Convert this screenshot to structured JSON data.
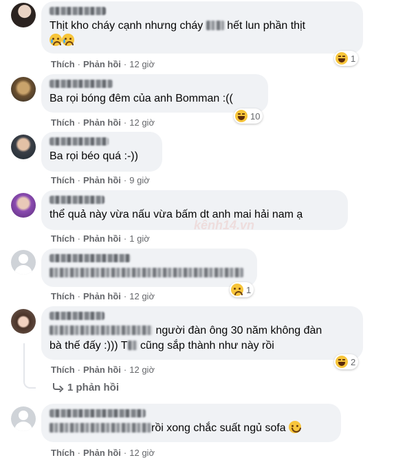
{
  "labels": {
    "like": "Thích",
    "reply": "Phản hồi",
    "separator": "·"
  },
  "colors": {
    "bubble": "#f0f2f5",
    "meta": "#65676b",
    "text": "#050505",
    "reaction_emoji": "#f7c53b"
  },
  "comments": [
    {
      "avatar": "photo-woman",
      "text_before": "Thịt kho cháy cạnh nhưng cháy",
      "text_after": "hết lun phần thịt",
      "text_line2_emoji": "crying-face x2",
      "reaction": {
        "emoji": "haha",
        "count": "1"
      },
      "time": "12 giờ"
    },
    {
      "avatar": "photo-cartoon",
      "text": "Ba rọi bóng đêm của anh Bomman :((",
      "reaction": {
        "emoji": "haha",
        "count": "10"
      },
      "time": "12 giờ"
    },
    {
      "avatar": "photo-man",
      "text": "Ba rọi béo quá :-))",
      "time": "9 giờ"
    },
    {
      "avatar": "photo-purple",
      "text": "thể quả này vừa nấu vừa bấm dt anh mai hải nam ạ",
      "time": "1 giờ"
    },
    {
      "avatar": "generic",
      "reaction": {
        "emoji": "sad",
        "count": "1"
      },
      "time": "12 giờ"
    },
    {
      "avatar": "photo-girl",
      "text_line1": "người đàn ông 30 năm không đàn",
      "text_line2_before": "bà thế đấy :))) T",
      "text_line2_after": "cũng sắp thành như này rồi",
      "reaction": {
        "emoji": "haha",
        "count": "2"
      },
      "time": "12 giờ"
    },
    {
      "avatar": "generic",
      "text": "rồi xong chắc suất ngủ sofa",
      "text_emoji": "smiling-face",
      "time": "12 giờ"
    }
  ],
  "replies_link": "1 phản hồi",
  "watermark": "kênh14.vn"
}
